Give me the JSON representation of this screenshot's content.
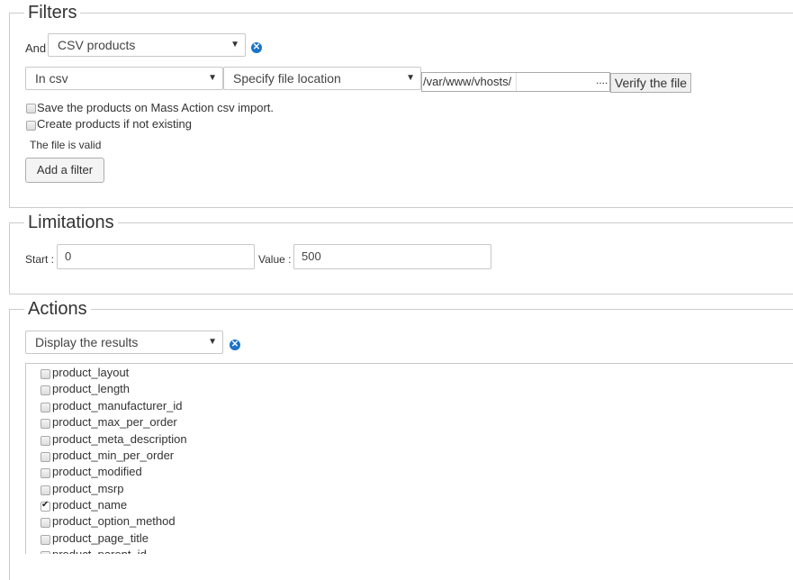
{
  "filters": {
    "legend": "Filters",
    "and_label": "And",
    "type_select": "CSV products",
    "in_select": "In csv",
    "location_select": "Specify file location",
    "file_path": "/var/www/vhosts/",
    "file_path_hidden_suffix": "....",
    "verify_button": "Verify the file",
    "save_products_label": "Save the products on Mass Action csv import.",
    "create_products_label": "Create products if not existing",
    "file_status": "The file is valid",
    "add_filter_button": "Add a filter"
  },
  "limitations": {
    "legend": "Limitations",
    "start_label": "Start :",
    "start_value": "0",
    "value_label": "Value :",
    "value_value": "500"
  },
  "actions": {
    "legend": "Actions",
    "action_select": "Display the results",
    "fields": [
      {
        "label": "product_layout",
        "checked": false
      },
      {
        "label": "product_length",
        "checked": false
      },
      {
        "label": "product_manufacturer_id",
        "checked": false
      },
      {
        "label": "product_max_per_order",
        "checked": false
      },
      {
        "label": "product_meta_description",
        "checked": false
      },
      {
        "label": "product_min_per_order",
        "checked": false
      },
      {
        "label": "product_modified",
        "checked": false
      },
      {
        "label": "product_msrp",
        "checked": false
      },
      {
        "label": "product_name",
        "checked": true
      },
      {
        "label": "product_option_method",
        "checked": false
      },
      {
        "label": "product_page_title",
        "checked": false
      },
      {
        "label": "product_parent_id",
        "checked": false
      }
    ]
  },
  "colors": {
    "remove_icon": "#1a73c8",
    "border": "#cccccc"
  }
}
